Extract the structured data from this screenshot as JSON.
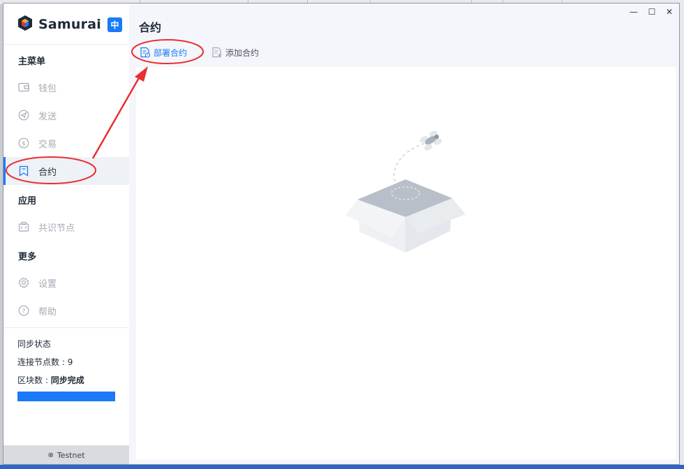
{
  "app": {
    "name": "Samurai",
    "lang_button": "中"
  },
  "sidebar": {
    "sections": {
      "main": "主菜单",
      "apps": "应用",
      "more": "更多"
    },
    "items": [
      {
        "label": "钱包",
        "icon": "wallet-icon"
      },
      {
        "label": "发送",
        "icon": "send-icon"
      },
      {
        "label": "交易",
        "icon": "transaction-icon"
      },
      {
        "label": "合约",
        "icon": "contract-icon",
        "active": true
      },
      {
        "label": "共识节点",
        "icon": "consensus-node-icon"
      },
      {
        "label": "设置",
        "icon": "gear-icon"
      },
      {
        "label": "帮助",
        "icon": "help-icon"
      }
    ]
  },
  "sync": {
    "title": "同步状态",
    "peers_label": "连接节点数 : ",
    "peers_value": "9",
    "blocks_label": "区块数 : ",
    "blocks_value": "同步完成",
    "progress": 1.0
  },
  "network": {
    "label": "Testnet"
  },
  "page": {
    "title": "合约",
    "toolbar": {
      "deploy_label": "部署合约",
      "add_label": "添加合约"
    }
  },
  "window_controls": {
    "minimize": "—",
    "maximize": "☐",
    "close": "✕"
  },
  "colors": {
    "accent": "#1a7af8",
    "annotation": "#e8302f",
    "muted": "#a4abb6"
  }
}
